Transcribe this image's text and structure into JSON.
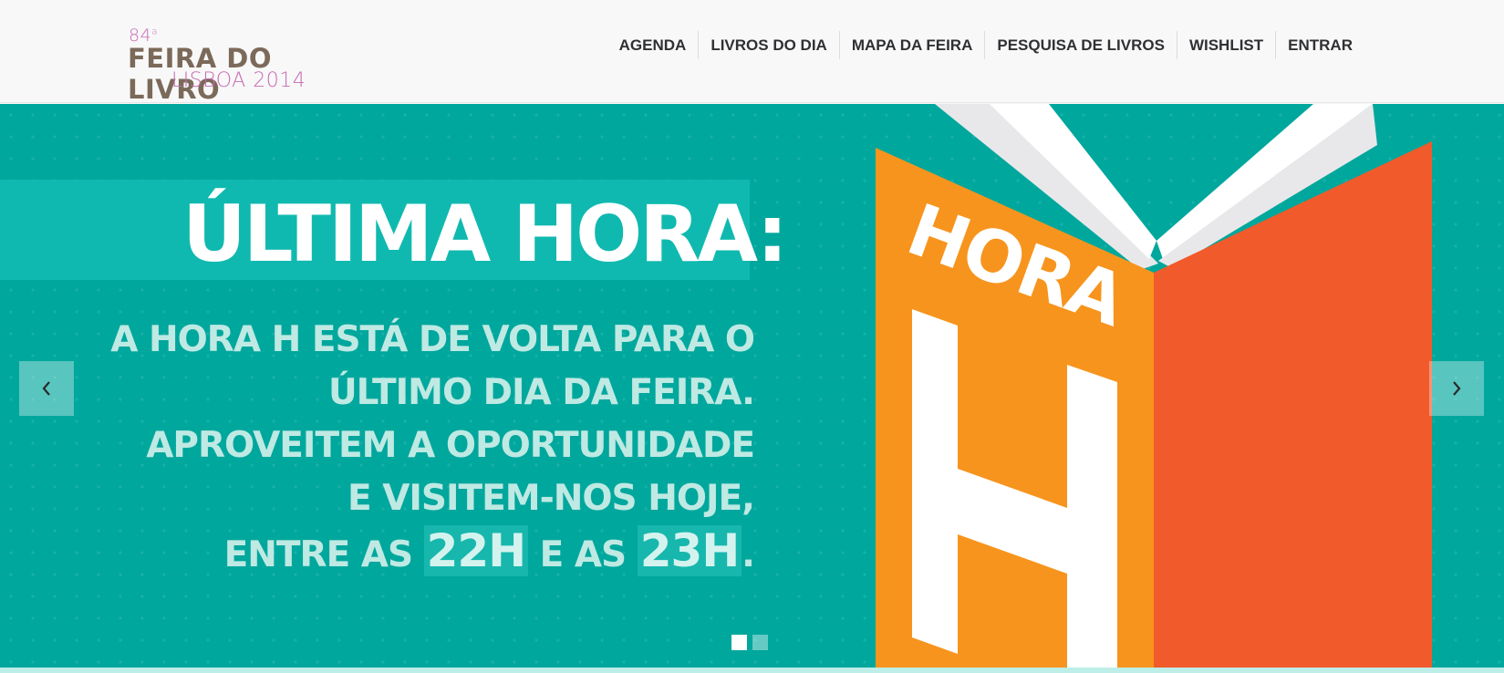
{
  "logo": {
    "edition": "84",
    "edition_sup": "a",
    "name": "FEIRA DO LIVRO",
    "city": "LISBOA 2014"
  },
  "nav": {
    "items": [
      {
        "label": "AGENDA"
      },
      {
        "label": "LIVROS DO DIA"
      },
      {
        "label": "MAPA DA FEIRA"
      },
      {
        "label": "PESQUISA DE LIVROS"
      },
      {
        "label": "WISHLIST"
      },
      {
        "label": "ENTRAR"
      }
    ]
  },
  "slide": {
    "title": "ÚLTIMA HORA:",
    "lines": [
      "A HORA H ESTÁ DE VOLTA PARA O",
      "ÚLTIMO DIA DA FEIRA.",
      "APROVEITEM A OPORTUNIDADE",
      "E VISITEM-NOS HOJE,"
    ],
    "last_line_prefix": "ENTRE AS",
    "time1": "22H",
    "last_line_mid": "E AS",
    "time2": "23H",
    "last_line_suffix": ".",
    "book_word": "HORA",
    "book_letter": "H"
  },
  "carousel": {
    "prev_icon": "chevron-left-icon",
    "next_icon": "chevron-right-icon",
    "slide_count": 2,
    "active_index": 0
  },
  "colors": {
    "teal": "#00a79d",
    "banner": "#10b9af",
    "orange": "#f7941d",
    "red_orange": "#f15a2b",
    "logo_pink": "#c76bb5",
    "logo_brown": "#7b6a5a"
  }
}
